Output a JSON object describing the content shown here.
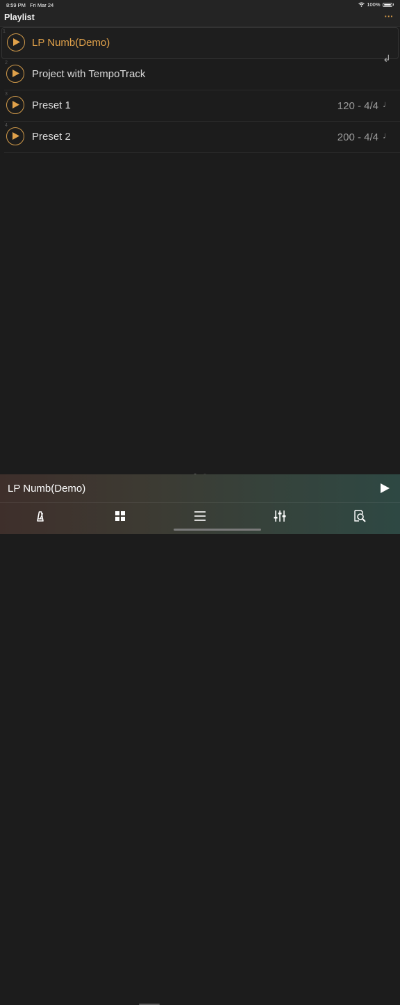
{
  "status": {
    "time": "8:59 PM",
    "date": "Fri Mar 24",
    "battery": "100%"
  },
  "nav": {
    "title": "Playlist",
    "more": "···"
  },
  "rows": [
    {
      "index": "1",
      "title": "LP Numb(Demo)",
      "meta": "",
      "note": ""
    },
    {
      "index": "2",
      "title": "Project with TempoTrack",
      "meta": "",
      "note": ""
    },
    {
      "index": "3",
      "title": "Preset 1",
      "meta": "120 - 4/4",
      "note": "♩"
    },
    {
      "index": "4",
      "title": "Preset 2",
      "meta": "200 - 4/4",
      "note": "♩"
    }
  ],
  "return_glyph": "↲",
  "now_playing": {
    "title": "LP Numb(Demo)"
  },
  "tabs": [
    "metronome-icon",
    "grid-icon",
    "list-icon",
    "mixer-icon",
    "search-doc-icon"
  ],
  "colors": {
    "accent": "#e0a14a",
    "background": "#1c1c1c"
  }
}
